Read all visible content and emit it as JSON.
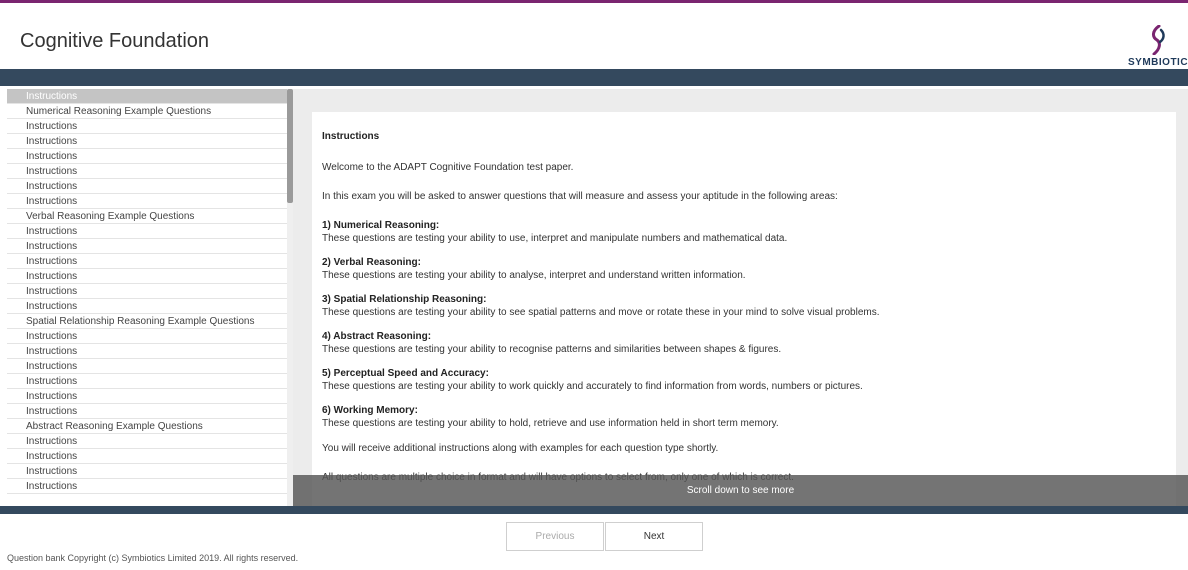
{
  "header": {
    "title": "Cognitive Foundation",
    "logo_text": "SYMBIOTICS",
    "logo_icon": "symbiotics-logo-icon",
    "brand_color": "#7a2570",
    "nav_color": "#34495e"
  },
  "sidebar": {
    "items": [
      {
        "label": "Instructions",
        "active": true
      },
      {
        "label": "Numerical Reasoning Example Questions"
      },
      {
        "label": "Instructions"
      },
      {
        "label": "Instructions"
      },
      {
        "label": "Instructions"
      },
      {
        "label": "Instructions"
      },
      {
        "label": "Instructions"
      },
      {
        "label": "Instructions"
      },
      {
        "label": "Verbal Reasoning Example Questions"
      },
      {
        "label": "Instructions"
      },
      {
        "label": "Instructions"
      },
      {
        "label": "Instructions"
      },
      {
        "label": "Instructions"
      },
      {
        "label": "Instructions"
      },
      {
        "label": "Instructions"
      },
      {
        "label": "Spatial Relationship Reasoning Example Questions"
      },
      {
        "label": "Instructions"
      },
      {
        "label": "Instructions"
      },
      {
        "label": "Instructions"
      },
      {
        "label": "Instructions"
      },
      {
        "label": "Instructions"
      },
      {
        "label": "Instructions"
      },
      {
        "label": "Abstract Reasoning Example Questions"
      },
      {
        "label": "Instructions"
      },
      {
        "label": "Instructions"
      },
      {
        "label": "Instructions"
      },
      {
        "label": "Instructions"
      }
    ]
  },
  "content": {
    "heading": "Instructions",
    "intro1": "Welcome to the ADAPT Cognitive Foundation test paper.",
    "intro2": "In this exam you will be asked to answer questions that will measure and assess your aptitude in the following areas:",
    "sections": [
      {
        "title": "1) Numerical Reasoning:",
        "text": "These questions are testing your ability to use, interpret and manipulate numbers and mathematical data."
      },
      {
        "title": "2) Verbal Reasoning:",
        "text": "These questions are testing your ability to analyse, interpret and understand written information."
      },
      {
        "title": "3) Spatial Relationship Reasoning:",
        "text": "These questions are testing your ability to see spatial patterns and move or rotate these in your mind to solve visual problems."
      },
      {
        "title": "4) Abstract Reasoning:",
        "text": "These questions are testing your ability to recognise patterns and similarities between shapes & figures."
      },
      {
        "title": "5) Perceptual Speed and Accuracy:",
        "text": "These questions are testing your ability to work quickly and accurately to find information from words, numbers or pictures."
      },
      {
        "title": "6) Working Memory:",
        "text": "These questions are testing your ability to hold, retrieve and use information held in short term memory."
      }
    ],
    "outro1": "You will receive additional instructions along with examples for each question type shortly.",
    "outro2": "All questions are multiple choice in format and will have options to select from, only one of which is correct.",
    "scroll_hint": "Scroll down to see more"
  },
  "buttons": {
    "previous": "Previous",
    "next": "Next"
  },
  "footer": {
    "copyright": "Question bank Copyright (c) Symbiotics Limited 2019. All rights reserved."
  }
}
